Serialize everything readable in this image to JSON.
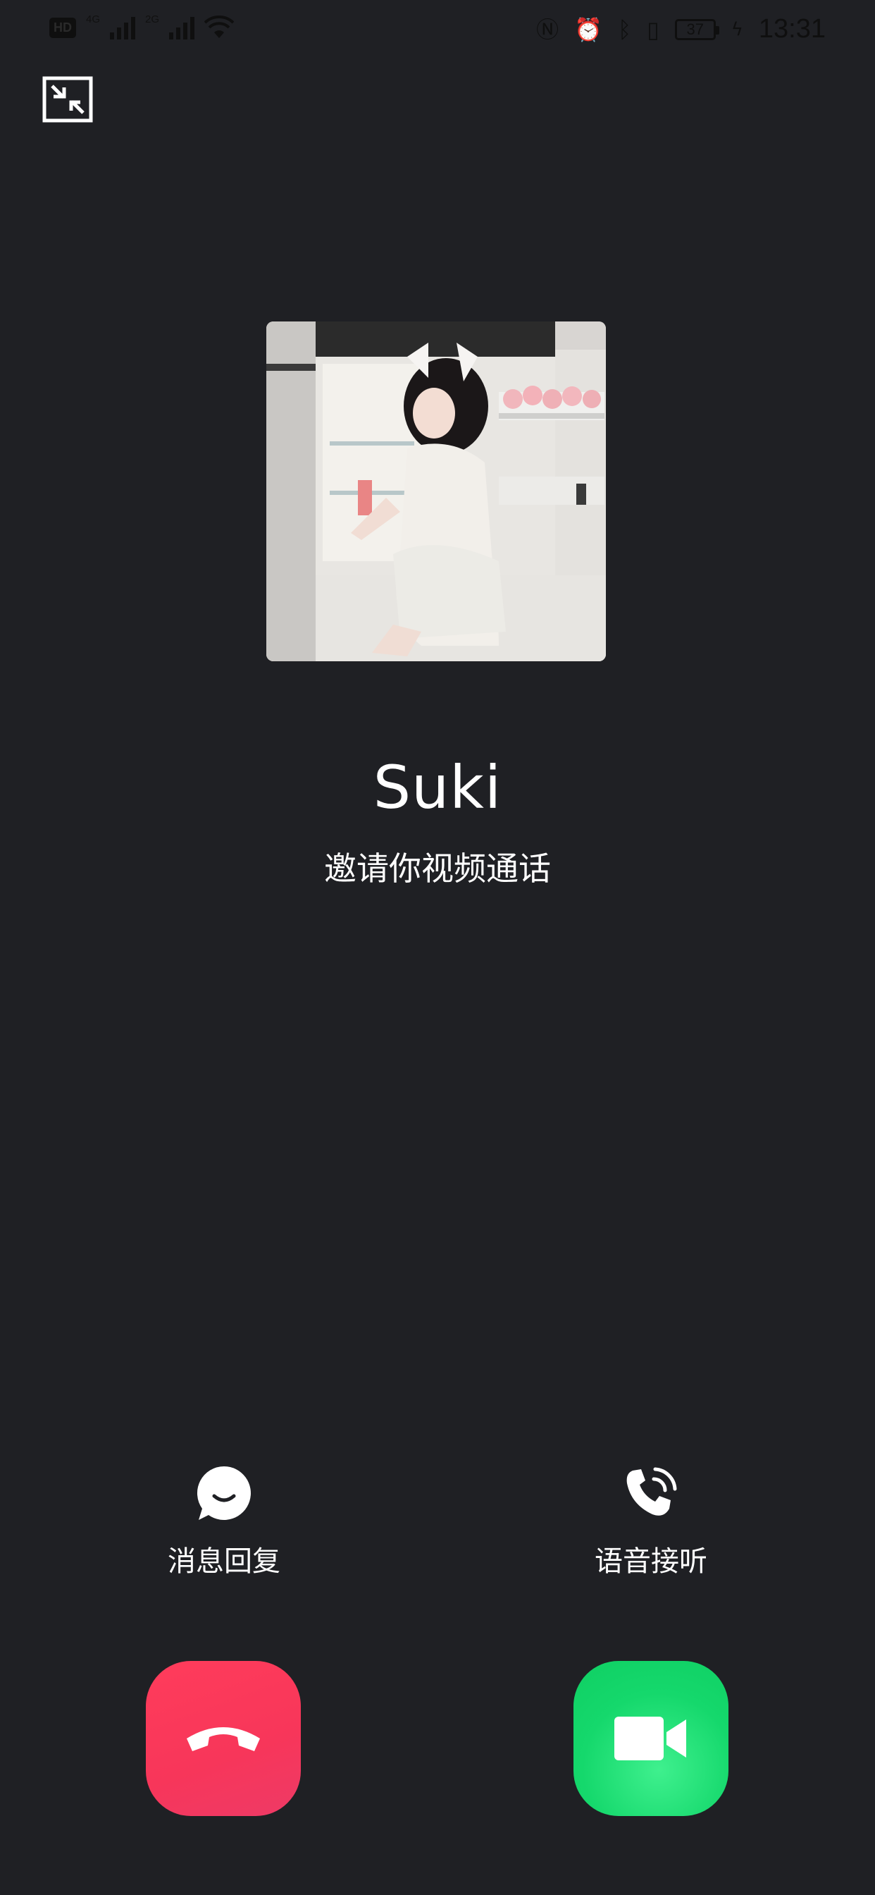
{
  "status_bar": {
    "hd": "HD",
    "net1": "4G",
    "net2": "2G",
    "battery": "37",
    "time": "13:31"
  },
  "caller": {
    "name": "Suki",
    "subtitle": "邀请你视频通话"
  },
  "actions": {
    "message_reply": "消息回复",
    "voice_answer": "语音接听"
  },
  "colors": {
    "background": "#1f2024",
    "decline": "#f7365a",
    "accept": "#15d86c"
  },
  "icons": {
    "minimize": "minimize-window-icon",
    "message": "chat-bubble-icon",
    "voice": "phone-ringing-icon",
    "decline": "hang-up-icon",
    "accept": "video-camera-icon"
  }
}
